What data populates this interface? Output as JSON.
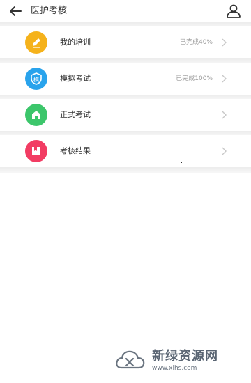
{
  "header": {
    "back_icon": "arrow-left-icon",
    "title": "医护考核",
    "user_icon": "user-icon"
  },
  "rows": [
    {
      "label": "我的培训",
      "status": "已完成40%",
      "icon": "pencil-icon",
      "color": "#f5b21b"
    },
    {
      "label": "模拟考试",
      "status": "已完成100%",
      "icon": "mock-exam-icon",
      "color": "#29a3ec"
    },
    {
      "label": "正式考试",
      "status": "",
      "icon": "house-icon",
      "color": "#3cc66b"
    },
    {
      "label": "考核结果",
      "status": "",
      "icon": "bookmark-icon",
      "color": "#f23c63"
    }
  ],
  "icon_glyphs": {
    "mock": "模"
  },
  "watermark": {
    "title": "新绿资源网",
    "url": "www.xlhs.com"
  }
}
